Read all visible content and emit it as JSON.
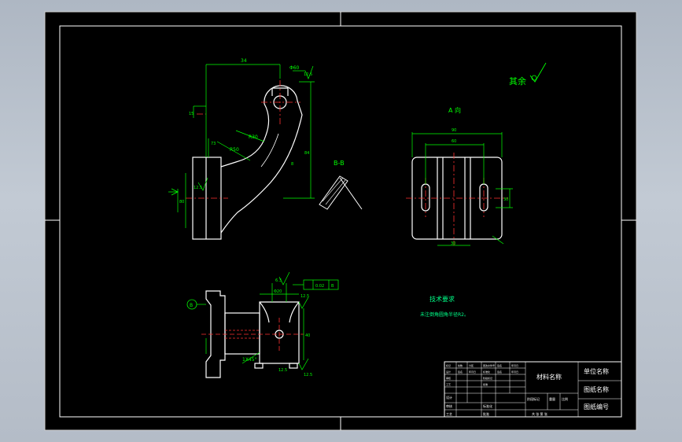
{
  "drawing": {
    "background": "#000000",
    "line_color": "#ffffff",
    "part_color": "#ffffff",
    "dim_color": "#00ff00",
    "center_color": "#ff3030",
    "text_color": "#00ff00",
    "note_color": "#00ff88",
    "surface_finish_note": "其余",
    "view_a_title": "A 向",
    "section_title": "B-B",
    "tech_title": "技术要求",
    "tech_body": "未注倒角圆角半径R2。"
  },
  "dims": {
    "front_width": "34",
    "top_dia": "Φ60",
    "roughness_top": "12.5",
    "left_15": "15",
    "r30": "R30",
    "r50": "R50",
    "dim_73": "73",
    "dim_84": "84",
    "dim_8": "8",
    "rough_left": "12.5",
    "dim_80": "80",
    "a_width_outer": "90",
    "a_width_inner": "60",
    "a_right": "30",
    "a_bottom": "30",
    "bot_r": "6.3",
    "bot_tol1": "0.02",
    "bot_tol2": "B",
    "bot_20": "Φ20",
    "bot_r2": "12.5",
    "bot_c": "1X45°",
    "bot_br": "12.5",
    "bot_40": "40",
    "bot_bot": "12.5",
    "balloon": "B"
  },
  "title_block": {
    "material": "材料名称",
    "unit": "单位名称",
    "drawing_name": "图纸名称",
    "drawing_no": "图纸编号",
    "mark_row": "标记 处数 分区 更改文件号 签名 年月日",
    "design": "设计",
    "check": "审核",
    "process": "工艺",
    "std": "标准化",
    "approve": "批准",
    "stage": "阶段标记",
    "weight": "重量",
    "scale": "比例",
    "sheets": "共 张 第 张"
  }
}
